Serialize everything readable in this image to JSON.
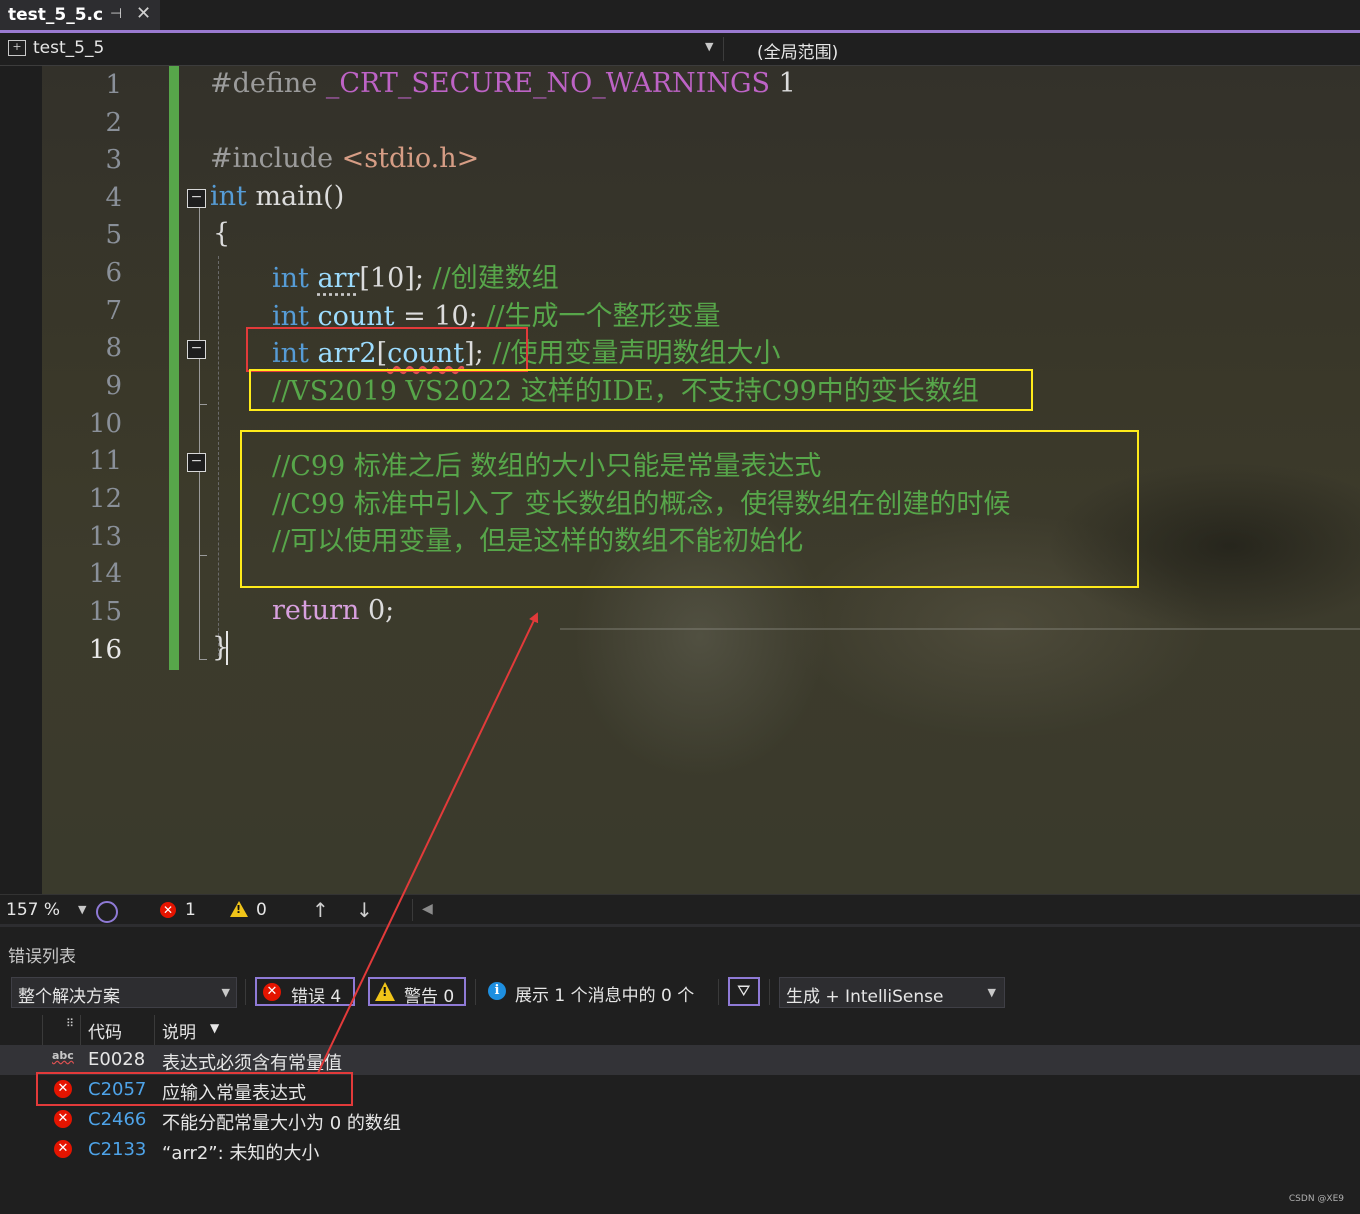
{
  "tab": {
    "filename": "test_5_5.c",
    "pin_glyph": "⊣",
    "close_glyph": "✕"
  },
  "nav": {
    "project": "test_5_5",
    "scope": "(全局范围)"
  },
  "editor": {
    "line_numbers": [
      "1",
      "2",
      "3",
      "4",
      "5",
      "6",
      "7",
      "8",
      "9",
      "10",
      "11",
      "12",
      "13",
      "14",
      "15",
      "16"
    ],
    "current_line": "16",
    "code": {
      "l1_define": "#define ",
      "l1_macro": "_CRT_SECURE_NO_WARNINGS",
      "l1_value": " 1",
      "l3_include": "#include ",
      "l3_header": "<stdio.h>",
      "l4_type": "int",
      "l4_rest": " main()",
      "l5": "{",
      "l6_type": "int",
      "l6_var": "arr",
      "l6_rest": "[10]; ",
      "l6_comment": "//创建数组",
      "l7_type": "int",
      "l7_var": "count",
      "l7_rest": " = 10; ",
      "l7_comment": "//生成一个整形变量",
      "l8_type": "int",
      "l8_var": "arr2",
      "l8_open": "[",
      "l8_count": "count",
      "l8_close": "]; ",
      "l8_comment": "//使用变量声明数组大小",
      "l9_comment": "//VS2019 VS2022 这样的IDE，不支持C99中的变长数组",
      "l11_comment": "//C99 标准之后 数组的大小只能是常量表达式",
      "l12_comment": "//C99 标准中引入了 变长数组的概念，使得数组在创建的时候",
      "l13_comment": "//可以使用变量，但是这样的数组不能初始化",
      "l15_kw": "return",
      "l15_rest": " 0;",
      "l16": "}"
    }
  },
  "status": {
    "zoom": "157 %",
    "errors": "1",
    "warnings": "0",
    "up": "↑",
    "down": "↓"
  },
  "error_list": {
    "title": "错误列表",
    "scope_filter": "整个解决方案",
    "errors_button": "错误 4",
    "warnings_button": "警告 0",
    "messages_text": "展示 1 个消息中的 0 个",
    "build_filter": "生成 + IntelliSense",
    "columns": {
      "code": "代码",
      "description": "说明"
    },
    "rows": [
      {
        "icon": "abc-icon",
        "code": "E0028",
        "description": "表达式必须含有常量值"
      },
      {
        "icon": "error-icon",
        "code": "C2057",
        "description": "应输入常量表达式"
      },
      {
        "icon": "error-icon",
        "code": "C2466",
        "description": "不能分配常量大小为 0 的数组"
      },
      {
        "icon": "error-icon",
        "code": "C2133",
        "description": "“arr2”: 未知的大小"
      }
    ]
  },
  "watermark": "CSDN @XE9",
  "colors": {
    "accent": "#9a7ad0",
    "error": "#e51400",
    "warning": "#f0c419",
    "annotation_red": "#e23a3a",
    "annotation_yellow": "#ffeb1a",
    "comment_green": "#57a64a",
    "keyword_blue": "#569cd6"
  }
}
